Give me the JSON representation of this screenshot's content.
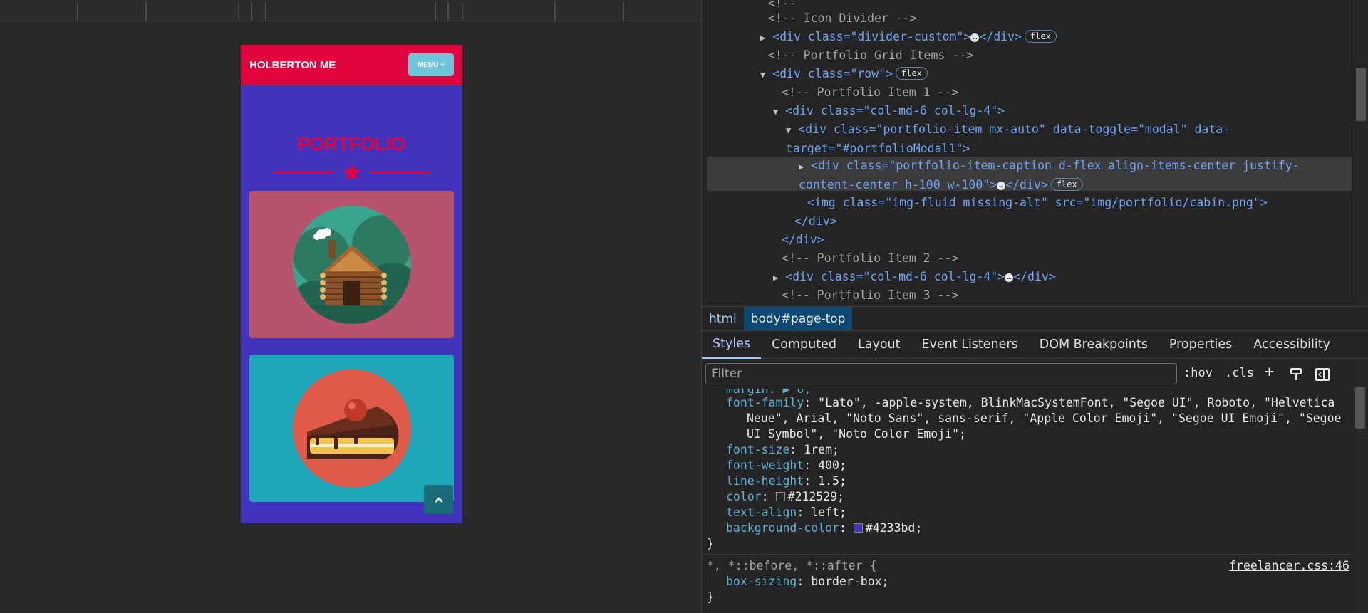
{
  "page": {
    "brand": "HOLBERTON ME",
    "menu_label": "MENU",
    "title": "PORTFOLIO"
  },
  "dom_lines": [
    "<!-- Icon Divider -->",
    "<div class=\"divider-custom\">",
    "<!-- Portfolio Grid Items -->",
    "<div class=\"row\">",
    "<!-- Portfolio Item 1 -->",
    "<div class=\"col-md-6 col-lg-4\">",
    "<div class=\"portfolio-item mx-auto\" data-toggle=\"modal\" data-target=\"#portfolioModal1\">",
    "<div class=\"portfolio-item-caption d-flex align-items-center justify-content-center h-100 w-100\">",
    "<img class=\"img-fluid missing-alt\" src=\"img/portfolio/cabin.png\">",
    "</div>",
    "</div>",
    "<!-- Portfolio Item 2 -->",
    "<div class=\"col-md-6 col-lg-4\">",
    "<!-- Portfolio Item 3 -->"
  ],
  "dom_badges": {
    "flex": "flex",
    "ellipsis": "…"
  },
  "breadcrumbs": [
    "html",
    "body#page-top"
  ],
  "tabs": [
    "Styles",
    "Computed",
    "Layout",
    "Event Listeners",
    "DOM Breakpoints",
    "Properties",
    "Accessibility"
  ],
  "filter": {
    "placeholder": "Filter",
    "hov": ":hov",
    "cls": ".cls",
    "plus": "+"
  },
  "styles": {
    "partial_top": "margin: ▶ 0;",
    "font_family_prop": "font-family",
    "font_family_val1": "\"Lato\", -apple-system, BlinkMacSystemFont, \"Segoe UI\", Roboto, \"Helvetica",
    "font_family_val2": "Neue\", Arial, \"Noto Sans\", sans-serif, \"Apple Color Emoji\", \"Segoe UI Emoji\", \"Segoe",
    "font_family_val3": "UI Symbol\", \"Noto Color Emoji\";",
    "font_size_prop": "font-size",
    "font_size_val": "1rem;",
    "font_weight_prop": "font-weight",
    "font_weight_val": "400;",
    "line_height_prop": "line-height",
    "line_height_val": "1.5;",
    "color_prop": "color",
    "color_val": "#212529;",
    "text_align_prop": "text-align",
    "text_align_val": "left;",
    "bg_prop": "background-color",
    "bg_val": "#4233bd;",
    "close1": "}",
    "rule2_selector": "*, *::before, *::after {",
    "rule2_source": "freelancer.css:46",
    "box_sizing_prop": "box-sizing",
    "box_sizing_val": "border-box;",
    "close2": "}"
  },
  "colors": {
    "color_swatch": "#212529",
    "bg_swatch": "#4233bd",
    "accent": "#e0053f"
  }
}
